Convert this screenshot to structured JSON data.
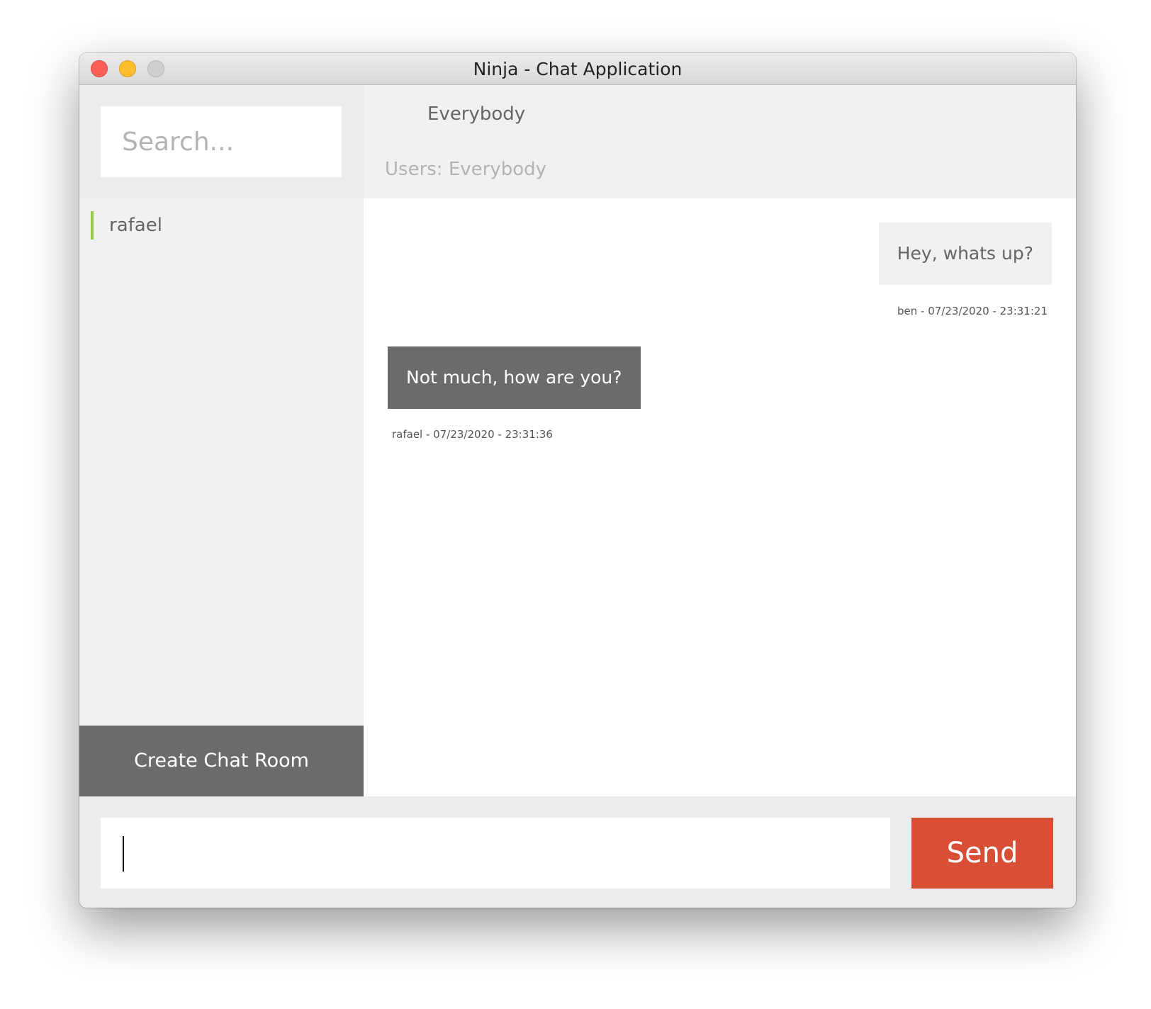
{
  "window": {
    "title": "Ninja - Chat Application"
  },
  "sidebar": {
    "search_placeholder": "Search...",
    "users": [
      {
        "name": "rafael"
      }
    ],
    "create_button_label": "Create Chat Room"
  },
  "chat": {
    "room_name": "Everybody",
    "users_label": "Users: Everybody",
    "messages": [
      {
        "text": "Hey, whats up?",
        "meta": "ben - 07/23/2020 - 23:31:21"
      },
      {
        "text": "Not much, how are you?",
        "meta": "rafael - 07/23/2020 - 23:31:36"
      }
    ]
  },
  "composer": {
    "value": "",
    "send_label": "Send"
  },
  "colors": {
    "accent_active_user": "#9cc94a",
    "send_button": "#d94f36",
    "dark_button": "#6b6b6b"
  }
}
